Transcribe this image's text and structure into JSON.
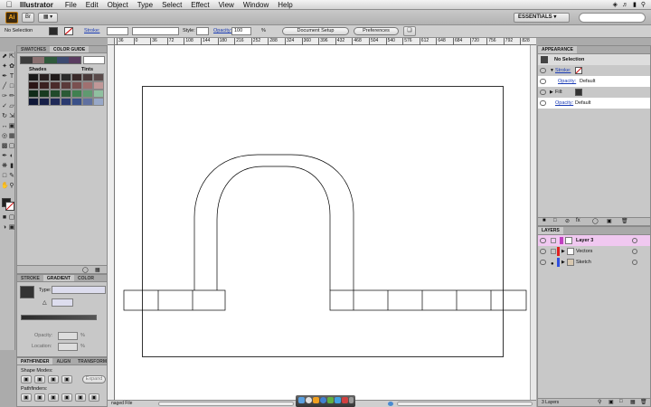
{
  "menubar": {
    "app_name": "Illustrator",
    "items": [
      "File",
      "Edit",
      "Object",
      "Type",
      "Select",
      "Effect",
      "View",
      "Window",
      "Help"
    ]
  },
  "appbar": {
    "logo": "Ai",
    "workspace": "ESSENTIALS"
  },
  "control": {
    "selection": "No Selection",
    "stroke_label": "Stroke:",
    "style_label": "Style:",
    "opacity_label": "Opacity:",
    "opacity_value": "100",
    "opacity_unit": "%",
    "document_setup": "Document Setup",
    "preferences": "Preferences"
  },
  "ruler": {
    "ticks": [
      "36",
      "0",
      "36",
      "72",
      "108",
      "144",
      "180",
      "216",
      "252",
      "288",
      "324",
      "360",
      "396",
      "432",
      "468",
      "504",
      "540",
      "576",
      "612",
      "648",
      "684",
      "720",
      "756",
      "792",
      "828"
    ]
  },
  "swatches_panel": {
    "tabs": [
      "SWATCHES",
      "COLOR GUIDE"
    ],
    "shades_label": "Shades",
    "tints_label": "Tints"
  },
  "stroke_panel": {
    "tabs": [
      "STROKE",
      "GRADIENT",
      "COLOR"
    ],
    "type_label": "Type:",
    "opacity_label": "Opacity:",
    "location_label": "Location:",
    "percent": "%"
  },
  "pathfinder_panel": {
    "tabs": [
      "PATHFINDER",
      "ALIGN",
      "TRANSFORM"
    ],
    "shape_modes": "Shape Modes:",
    "expand": "Expand",
    "pathfinders": "Pathfinders:"
  },
  "appearance_panel": {
    "title": "APPEARANCE",
    "selection": "No Selection",
    "stroke": "Stroke:",
    "opacity_label": "Opacity:",
    "opacity_value": "Default",
    "fill": "Fill:",
    "opacity_label_2": "Opacity:",
    "opacity_value_2": "Default"
  },
  "layers_panel": {
    "title": "LAYERS",
    "layers": [
      "Layer 3",
      "Vectors",
      "Sketch"
    ],
    "count": "3 Layers"
  },
  "statusbar": {
    "text": "naged File"
  },
  "colors": {
    "highlight_layer": "#f0c8f0",
    "accent_blue": "#1a3bb5"
  }
}
